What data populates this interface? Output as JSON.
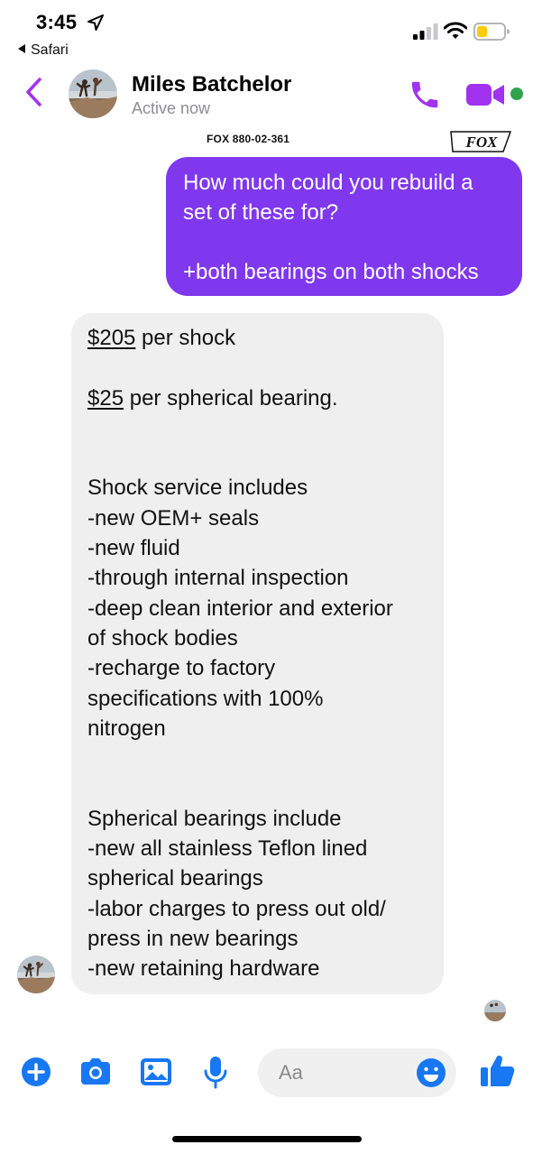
{
  "status_bar": {
    "time": "3:45",
    "back_app_label": "Safari"
  },
  "header": {
    "contact_name": "Miles Batchelor",
    "contact_status": "Active now"
  },
  "attachment": {
    "part_number": "FOX 880-02-361",
    "brand_logo_text": "FOX"
  },
  "messages": {
    "sent": {
      "line1": "How much could you rebuild a",
      "line2": "set of these for?",
      "line3": "+both bearings on both shocks"
    },
    "received": {
      "price_shock": "$205",
      "price_shock_suffix": " per shock",
      "price_bearing": "$25",
      "price_bearing_suffix": " per spherical bearing.",
      "shock_heading": "Shock service includes",
      "shock_items": [
        "-new OEM+ seals",
        "-new fluid",
        "-through internal inspection",
        "-deep clean interior and exterior",
        "of shock bodies",
        "-recharge to factory",
        "specifications with 100%",
        "nitrogen"
      ],
      "bearing_heading": "Spherical bearings include",
      "bearing_items": [
        "-new all stainless Teflon lined",
        "spherical bearings",
        "-labor charges to press out old/",
        "press in new bearings",
        "-new retaining hardware"
      ]
    }
  },
  "composer": {
    "placeholder": "Aa"
  },
  "icons": {
    "location": "location-arrow-icon",
    "back": "chevron-left-icon",
    "call": "phone-icon",
    "video": "video-camera-icon",
    "plus": "plus-icon",
    "camera": "camera-icon",
    "photo": "photo-icon",
    "mic": "microphone-icon",
    "emoji": "emoji-icon",
    "like": "thumbs-up-icon"
  },
  "colors": {
    "accent_purple": "#8038ee",
    "header_icon_purple": "#a032f0",
    "composer_blue": "#1877f2",
    "received_bubble": "#efefef",
    "online_green": "#31a24c"
  }
}
